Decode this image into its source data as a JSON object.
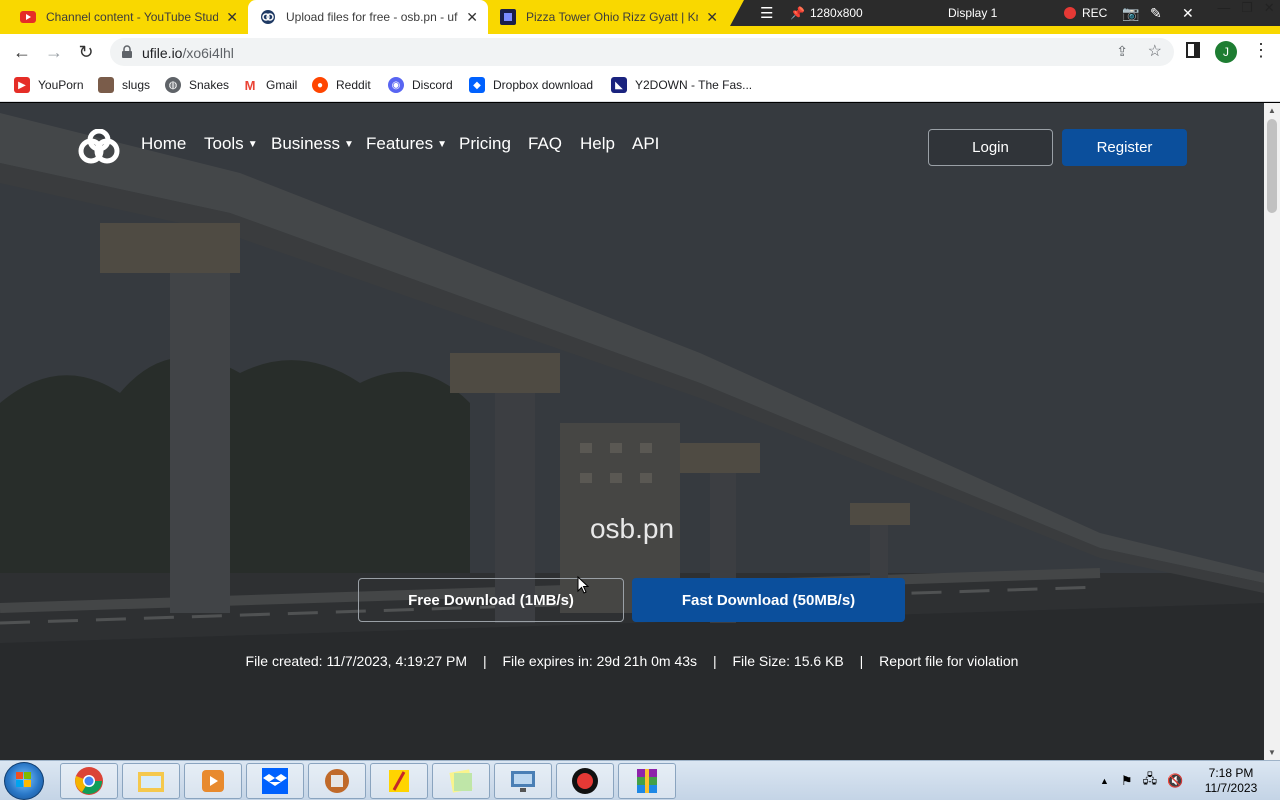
{
  "browser": {
    "tabs": [
      {
        "title": "Channel content - YouTube Studi",
        "favicon": "youtube-icon",
        "active": false
      },
      {
        "title": "Upload files for free - osb.pn - uf",
        "favicon": "ufile-icon",
        "active": true
      },
      {
        "title": "Pizza Tower Ohio Rizz Gyatt | Kn",
        "favicon": "knowyourmeme-icon",
        "active": false
      }
    ],
    "url_domain": "ufile.io",
    "url_path": "/xo6i4lhl",
    "profile_initial": "J"
  },
  "recorder": {
    "resolution": "1280x800",
    "display": "Display 1",
    "rec_label": "REC"
  },
  "bookmarks": [
    {
      "label": "YouPorn",
      "icon": "youtube-icon",
      "color": "#e52d27"
    },
    {
      "label": "slugs",
      "icon": "image-icon",
      "color": "#7a5c4a"
    },
    {
      "label": "Snakes",
      "icon": "globe-icon",
      "color": "#5f6368"
    },
    {
      "label": "Gmail",
      "icon": "gmail-icon",
      "color": "#ea4335"
    },
    {
      "label": "Reddit",
      "icon": "reddit-icon",
      "color": "#ff4500"
    },
    {
      "label": "Discord",
      "icon": "discord-icon",
      "color": "#5865f2"
    },
    {
      "label": "Dropbox download",
      "icon": "dropbox-icon",
      "color": "#0061fe"
    },
    {
      "label": "Y2DOWN - The Fas...",
      "icon": "y2down-icon",
      "color": "#1a237e"
    }
  ],
  "site": {
    "nav": [
      {
        "label": "Home",
        "dropdown": false
      },
      {
        "label": "Tools",
        "dropdown": true
      },
      {
        "label": "Business",
        "dropdown": true
      },
      {
        "label": "Features",
        "dropdown": true
      },
      {
        "label": "Pricing",
        "dropdown": false
      },
      {
        "label": "FAQ",
        "dropdown": false
      },
      {
        "label": "Help",
        "dropdown": false
      },
      {
        "label": "API",
        "dropdown": false
      }
    ],
    "login_label": "Login",
    "register_label": "Register",
    "file_name": "osb.pn",
    "free_download_label": "Free Download (1MB/s)",
    "fast_download_label": "Fast Download (50MB/s)",
    "file_created": "File created: 11/7/2023, 4:19:27 PM",
    "file_expires": "File expires in: 29d 21h 0m 43s",
    "file_size": "File Size: 15.6 KB",
    "report_label": "Report file for violation",
    "separator": "|",
    "accent_color": "#0b4f9c"
  },
  "taskbar": {
    "time": "7:18 PM",
    "date": "11/7/2023",
    "apps": [
      "chrome-icon",
      "file-explorer-icon",
      "media-player-icon",
      "dropbox-icon",
      "app-icon",
      "notes-icon",
      "sticky-notes-icon",
      "network-app-icon",
      "record-icon",
      "winrar-icon"
    ]
  }
}
